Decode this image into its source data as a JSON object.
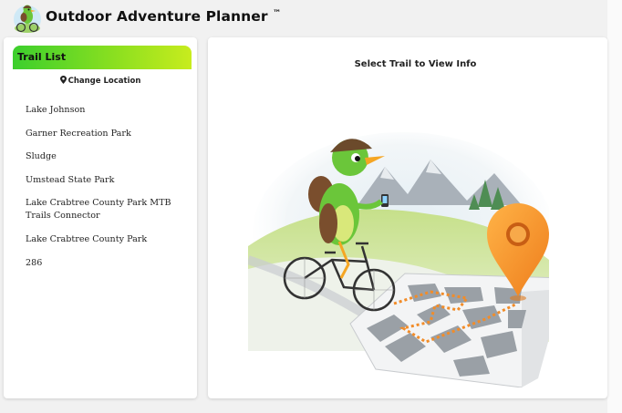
{
  "header": {
    "title": "Outdoor Adventure Planner",
    "trademark": "™",
    "logo_icon": "bird-cyclist-logo-icon"
  },
  "sidebar": {
    "title": "Trail List",
    "change_location_label": "Change Location",
    "change_location_icon": "map-marker-icon",
    "trails": [
      "Lake Johnson",
      "Garner Recreation Park",
      "Sludge",
      "Umstead State Park",
      "Lake Crabtree County Park MTB Trails Connector",
      "Lake Crabtree County Park",
      "286"
    ]
  },
  "main": {
    "title": "Select Trail to View Info",
    "illustration": "bird-riding-bicycle-with-map-pin-illustration"
  },
  "colors": {
    "header_gradient_start": "#3ccf2d",
    "header_gradient_end": "#c8ec1e",
    "pin_orange": "#f59a23",
    "bird_green": "#6bc63a"
  }
}
